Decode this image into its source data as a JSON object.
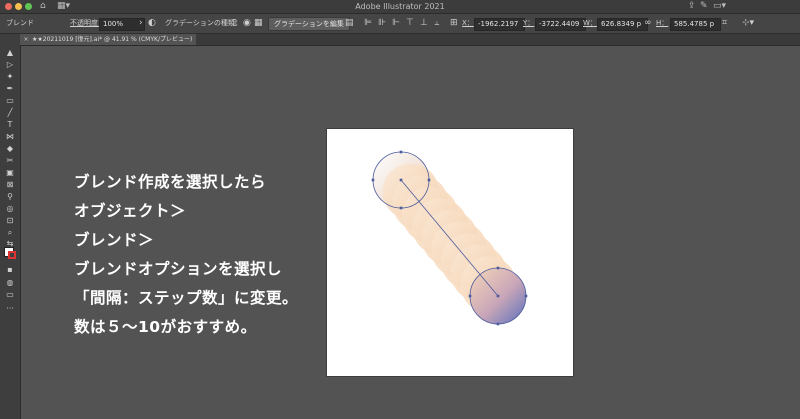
{
  "app": {
    "title": "Adobe Illustrator 2021"
  },
  "titlebar": {
    "home_icon": "home-icon",
    "workspace_icon": "workspace-grid-icon"
  },
  "controlbar": {
    "selection_label": "ブレンド",
    "opacity_label": "不透明度：",
    "opacity_value": "100%",
    "gradient_type_label": "グラデーションの種類：",
    "edit_gradient_button": "グラデーションを編集",
    "x_label": "X：",
    "x_value": "-1962.2197",
    "y_label": "Y：",
    "y_value": "-3722.4409",
    "w_label": "W：",
    "w_value": "626.8349 p",
    "h_label": "H：",
    "h_value": "585.4785 p"
  },
  "document": {
    "tab_label": "★★20211019 [復元].ai* @ 41.91 % (CMYK/プレビュー)"
  },
  "caption": {
    "line1": "ブレンド作成を選択したら",
    "line2": "オブジェクト＞",
    "line3": "ブレンド＞",
    "line4": "ブレンドオプションを選択し",
    "line5": "「間隔：ステップ数」に変更。",
    "line6": "数は５～10がおすすめ。"
  },
  "blend": {
    "steps": 9,
    "start_color": "#e6ecf8",
    "mid_color": "#f6d7b8",
    "end_color": "#5a6fbc",
    "path_color": "#4a5a9c"
  },
  "colors": {
    "canvas_bg": "#535353",
    "panel_bg": "#454545",
    "artboard_bg": "#ffffff"
  }
}
